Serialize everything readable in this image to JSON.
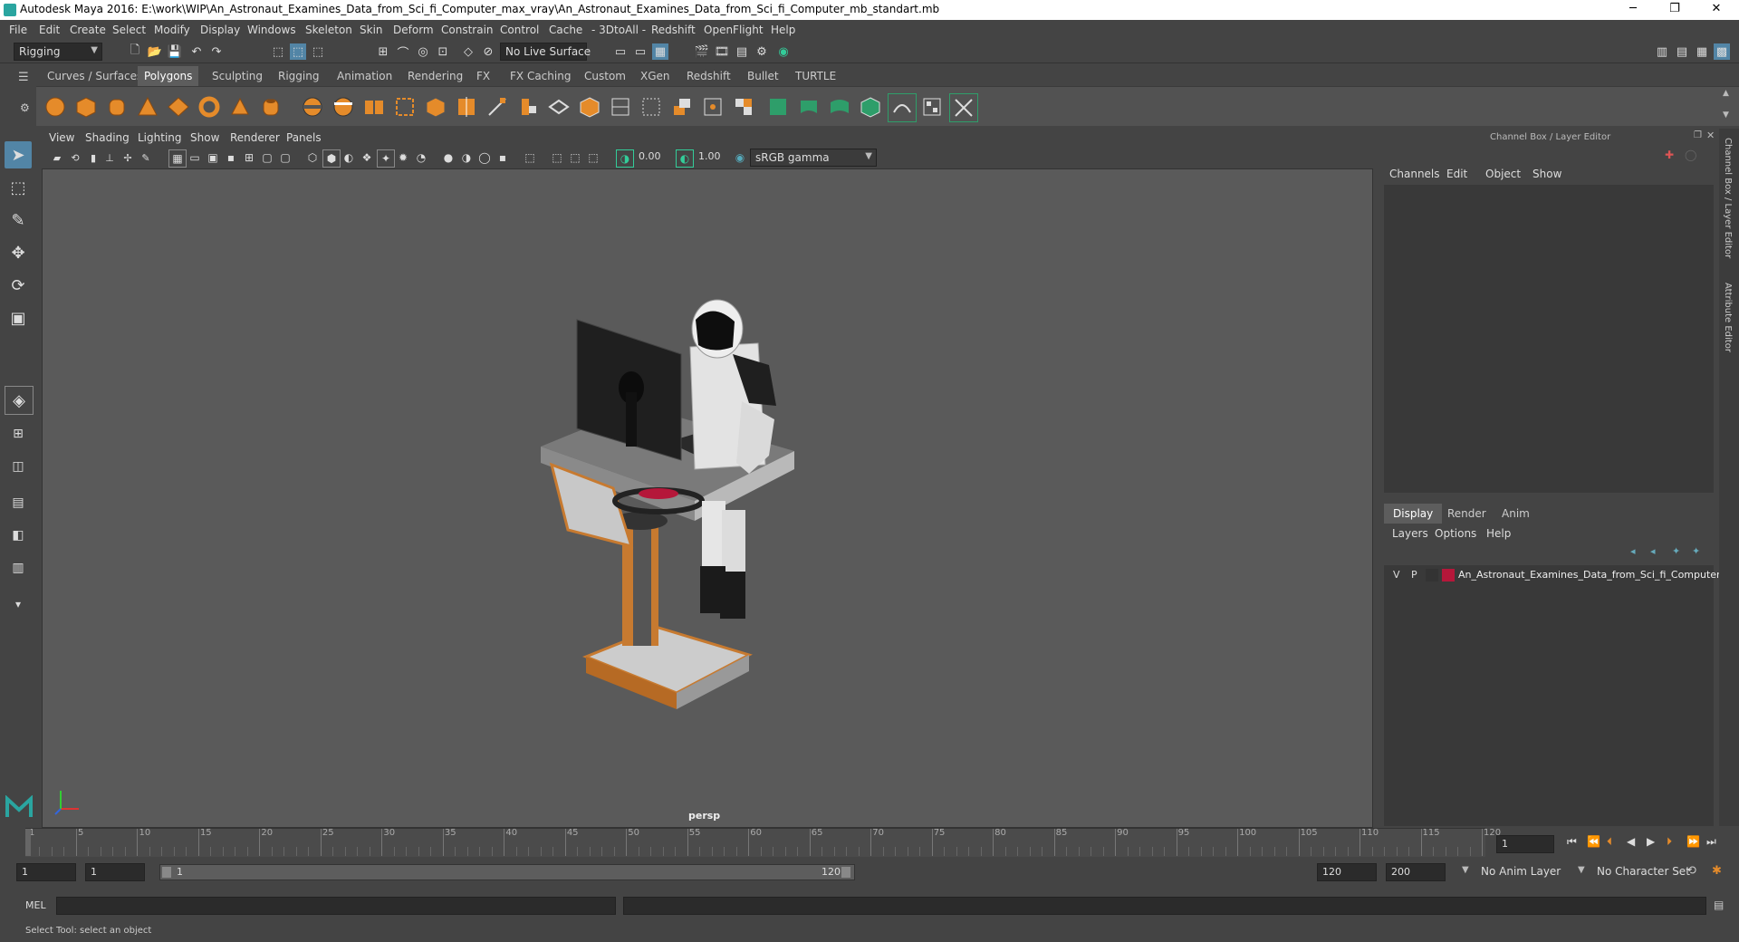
{
  "titlebar": {
    "title": "Autodesk Maya 2016: E:\\work\\WIP\\An_Astronaut_Examines_Data_from_Sci_fi_Computer_max_vray\\An_Astronaut_Examines_Data_from_Sci_fi_Computer_mb_standart.mb",
    "minimize": "─",
    "restore": "❐",
    "close": "✕"
  },
  "menus": [
    "File",
    "Edit",
    "Create",
    "Select",
    "Modify",
    "Display",
    "Windows",
    "Skeleton",
    "Skin",
    "Deform",
    "Constrain",
    "Control",
    "Cache",
    "- 3DtoAll -",
    "Redshift",
    "OpenFlight",
    "Help"
  ],
  "status": {
    "mode": "Rigging",
    "live_surface": "No Live Surface"
  },
  "shelf_tabs": [
    "Curves / Surfaces",
    "Polygons",
    "Sculpting",
    "Rigging",
    "Animation",
    "Rendering",
    "FX",
    "FX Caching",
    "Custom",
    "XGen",
    "Redshift",
    "Bullet",
    "TURTLE"
  ],
  "shelf_active": "Polygons",
  "viewport": {
    "menus": [
      "View",
      "Shading",
      "Lighting",
      "Show",
      "Renderer",
      "Panels"
    ],
    "exposure": "0.00",
    "gamma": "1.00",
    "colorspace": "sRGB gamma",
    "camera": "persp"
  },
  "channelbox": {
    "title": "Channel Box / Layer Editor",
    "menus": [
      "Channels",
      "Edit",
      "Object",
      "Show"
    ],
    "layer_tabs": [
      "Display",
      "Render",
      "Anim"
    ],
    "layer_menus": [
      "Layers",
      "Options",
      "Help"
    ],
    "layer": {
      "v": "V",
      "p": "P",
      "name": "An_Astronaut_Examines_Data_from_Sci_fi_Computer",
      "color": "#b5173a"
    }
  },
  "side_tabs": [
    "Channel Box / Layer Editor",
    "Attribute Editor"
  ],
  "timeline": {
    "ticks": [
      "1",
      "5",
      "10",
      "15",
      "20",
      "25",
      "30",
      "35",
      "40",
      "45",
      "50",
      "55",
      "60",
      "65",
      "70",
      "75",
      "80",
      "85",
      "90",
      "95",
      "100",
      "105",
      "110",
      "115",
      "120"
    ],
    "current_frame": "1"
  },
  "range": {
    "start": "1",
    "playback_start": "1",
    "slider_start": "1",
    "slider_end": "120",
    "playback_end": "120",
    "end": "200",
    "anim_layer": "No Anim Layer",
    "character_set": "No Character Set"
  },
  "mel": {
    "label": "MEL"
  },
  "help": {
    "text": "Select Tool: select an object"
  },
  "colors": {
    "accent": "#5285a6",
    "active_tab": "#5d5d5d"
  }
}
